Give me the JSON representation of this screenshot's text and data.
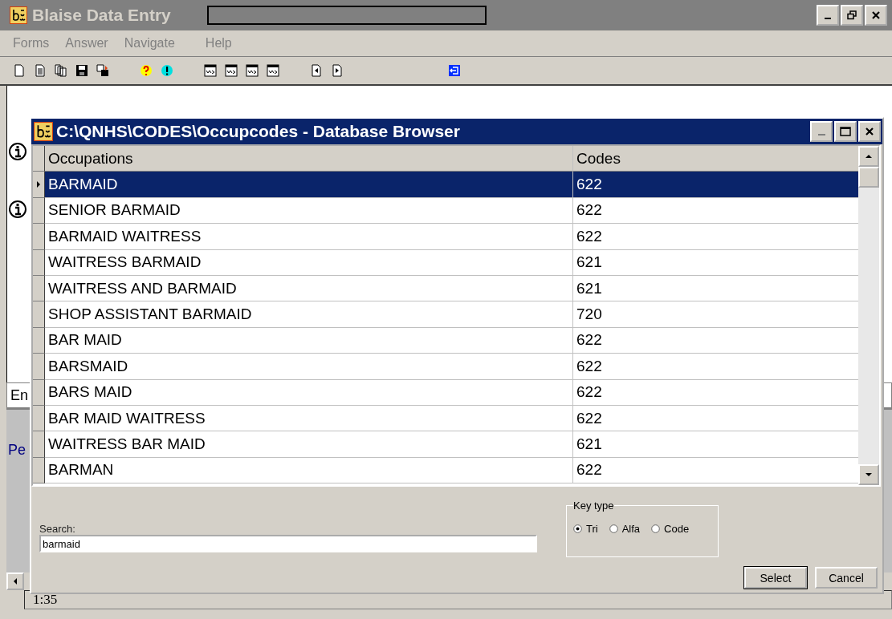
{
  "window": {
    "title": "Blaise Data Entry"
  },
  "menu": [
    {
      "label": "Forms"
    },
    {
      "label": "Answer"
    },
    {
      "label": "Navigate"
    },
    {
      "label": "Help"
    }
  ],
  "background": {
    "field_text": "En",
    "panel_text": "Pe",
    "status": "1:35"
  },
  "dialog": {
    "title": "C:\\QNHS\\CODES\\Occupcodes - Database Browser",
    "columns": [
      "Occupations",
      "Codes"
    ],
    "rows": [
      {
        "occupation": "BARMAID",
        "code": "622",
        "selected": true
      },
      {
        "occupation": "SENIOR BARMAID",
        "code": "622",
        "selected": false
      },
      {
        "occupation": "BARMAID WAITRESS",
        "code": "622",
        "selected": false
      },
      {
        "occupation": "WAITRESS BARMAID",
        "code": "621",
        "selected": false
      },
      {
        "occupation": "WAITRESS AND BARMAID",
        "code": "621",
        "selected": false
      },
      {
        "occupation": "SHOP ASSISTANT BARMAID",
        "code": "720",
        "selected": false
      },
      {
        "occupation": "BAR MAID",
        "code": "622",
        "selected": false
      },
      {
        "occupation": "BARSMAID",
        "code": "622",
        "selected": false
      },
      {
        "occupation": "BARS MAID",
        "code": "622",
        "selected": false
      },
      {
        "occupation": "BAR MAID WAITRESS",
        "code": "622",
        "selected": false
      },
      {
        "occupation": "WAITRESS BAR MAID",
        "code": "621",
        "selected": false
      },
      {
        "occupation": "BARMAN",
        "code": "622",
        "selected": false
      }
    ],
    "search": {
      "label": "Search:",
      "value": "barmaid"
    },
    "key_type": {
      "label": "Key type",
      "options": [
        {
          "label": "Tri",
          "selected": true
        },
        {
          "label": "Alfa",
          "selected": false
        },
        {
          "label": "Code",
          "selected": false
        }
      ]
    },
    "buttons": [
      "Select",
      "Cancel"
    ]
  }
}
